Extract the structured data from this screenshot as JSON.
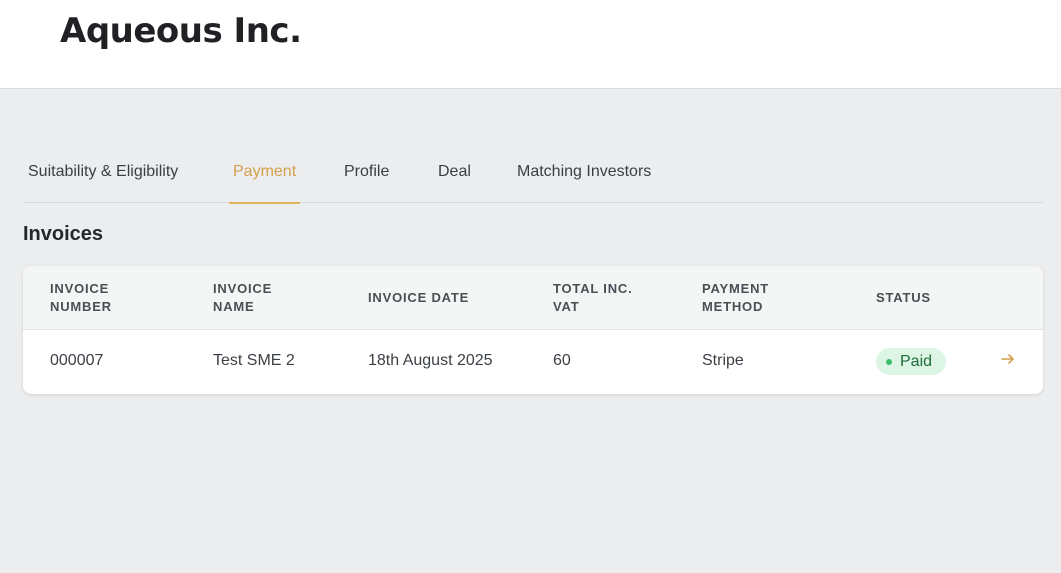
{
  "header": {
    "brand": "Aqueous Inc."
  },
  "tabs": [
    {
      "label": "Suitability & Eligibility",
      "active": false
    },
    {
      "label": "Payment",
      "active": true
    },
    {
      "label": "Profile",
      "active": false
    },
    {
      "label": "Deal",
      "active": false
    },
    {
      "label": "Matching Investors",
      "active": false
    }
  ],
  "section": {
    "title": "Invoices"
  },
  "table": {
    "columns": [
      "INVOICE NUMBER",
      "INVOICE NAME",
      "INVOICE DATE",
      "TOTAL INC. VAT",
      "PAYMENT METHOD",
      "STATUS"
    ],
    "rows": [
      {
        "invoice_number": "000007",
        "invoice_name": "Test SME 2",
        "invoice_date": "18th August 2025",
        "total_inc_vat": "60",
        "payment_method": "Stripe",
        "status": "Paid",
        "action_icon": "arrow-right-icon"
      }
    ]
  },
  "colors": {
    "accent": "#d4a04c",
    "status_paid_bg": "#dcf5e4",
    "status_paid_text": "#1f6b3a",
    "status_paid_dot": "#3bbf6b",
    "page_bg": "#ecedef"
  }
}
